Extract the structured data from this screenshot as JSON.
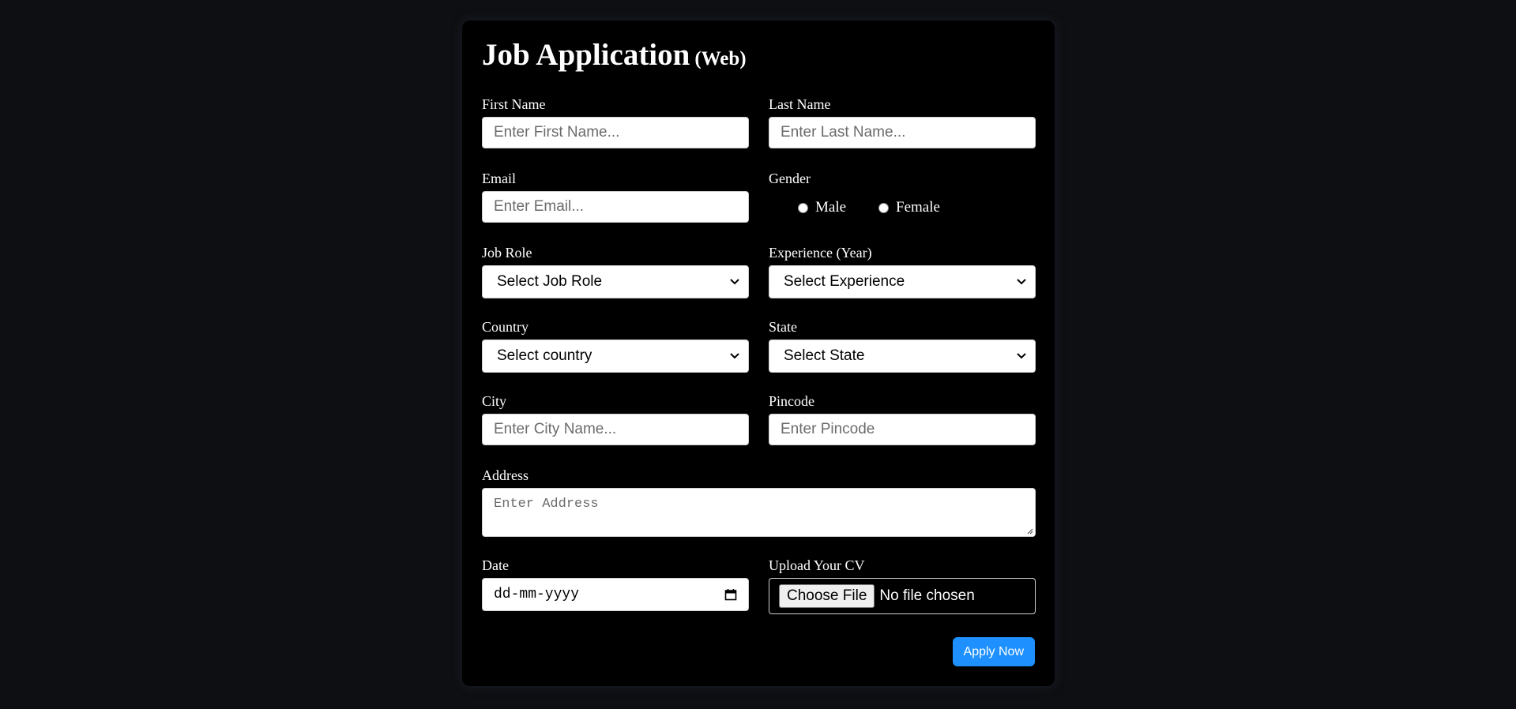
{
  "form": {
    "title": "Job Application",
    "title_suffix": "(Web)",
    "first_name": {
      "label": "First Name",
      "placeholder": "Enter First Name..."
    },
    "last_name": {
      "label": "Last Name",
      "placeholder": "Enter Last Name..."
    },
    "email": {
      "label": "Email",
      "placeholder": "Enter Email..."
    },
    "gender": {
      "label": "Gender",
      "options": [
        "Male",
        "Female"
      ]
    },
    "job_role": {
      "label": "Job Role",
      "selected": "Select Job Role"
    },
    "experience": {
      "label": "Experience (Year)",
      "selected": "Select Experience"
    },
    "country": {
      "label": "Country",
      "selected": "Select country"
    },
    "state": {
      "label": "State",
      "selected": "Select State"
    },
    "city": {
      "label": "City",
      "placeholder": "Enter City Name..."
    },
    "pincode": {
      "label": "Pincode",
      "placeholder": "Enter Pincode"
    },
    "address": {
      "label": "Address",
      "placeholder": "Enter Address"
    },
    "date": {
      "label": "Date",
      "placeholder": "dd-mm-yyyy"
    },
    "cv": {
      "label": "Upload Your CV",
      "button": "Choose File",
      "status": "No file chosen"
    },
    "submit": "Apply Now"
  },
  "colors": {
    "page_background": "#0e0f12",
    "card_background": "#000000",
    "accent": "#1e90ff",
    "text": "#ffffff"
  },
  "icons": [
    "chevron-down-icon",
    "calendar-icon",
    "resize-grip-icon"
  ]
}
